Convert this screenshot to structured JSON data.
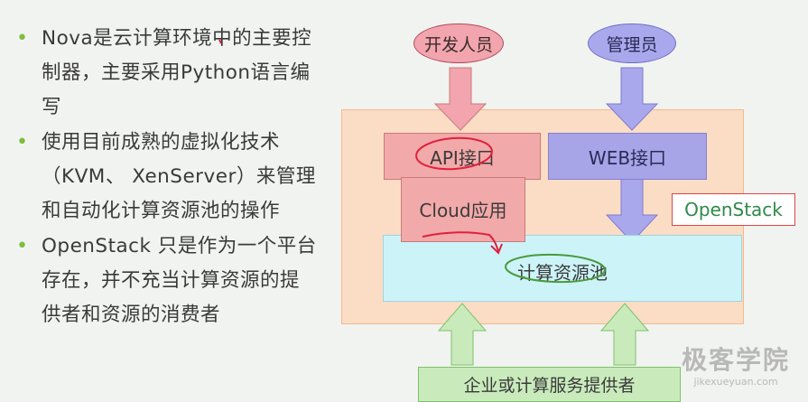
{
  "bullets": [
    {
      "lines": [
        "Nova是云计算环境中的主要控",
        "制器，主要采用Python语言编",
        "写"
      ]
    },
    {
      "lines": [
        "使用目前成熟的虚拟化技术",
        "（KVM、 XenServer）来管理",
        "和自动化计算资源池的操作"
      ]
    },
    {
      "lines": [
        "OpenStack 只是作为一个平台",
        "存在，并不充当计算资源的提",
        "供者和资源的消费者"
      ]
    }
  ],
  "diagram": {
    "developer": "开发人员",
    "admin": "管理员",
    "api": "API接口",
    "web": "WEB接口",
    "cloud": "Cloud应用",
    "pool": "计算资源池",
    "openstack": "OpenStack",
    "provider": "企业或计算服务提供者"
  },
  "watermark": {
    "title": "极客学院",
    "url": "jikexueyuan.com"
  },
  "colors": {
    "bullet_dot": "#7dbf3c",
    "frame": "#fbdcc4",
    "developer_fill": "#f2a5ae",
    "admin_fill": "#a9a8ec",
    "pool_fill": "#ccf4f8",
    "provider_fill": "#c9ebbc",
    "annotation": "#e0203c"
  }
}
